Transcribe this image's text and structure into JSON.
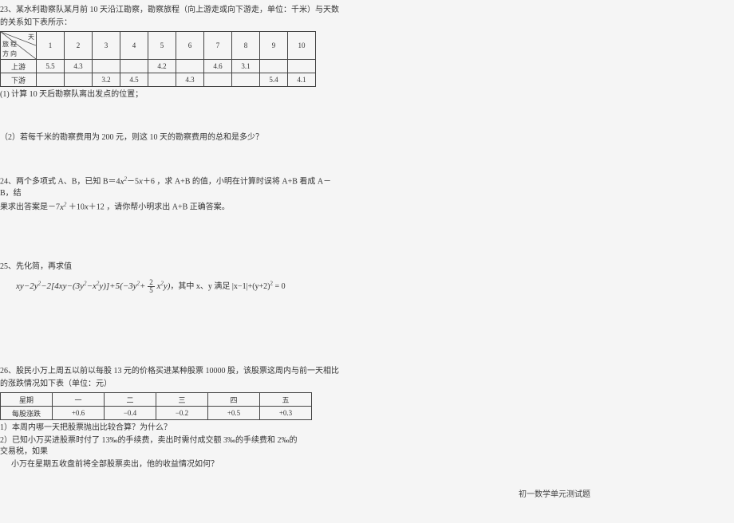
{
  "q23": {
    "intro1": "23、某水利勘察队某月前 10 天沿江勘察，勘察旅程（向上游走或向下游走，单位：千米）与天数",
    "intro2": "的关系如下表所示：",
    "diag_top": "天",
    "diag_mid": "旅 程",
    "diag_bot": "方 向",
    "days": [
      "1",
      "2",
      "3",
      "4",
      "5",
      "6",
      "7",
      "8",
      "9",
      "10"
    ],
    "row_up_label": "上游",
    "row_up": [
      "5.5",
      "4.3",
      "",
      "",
      "4.2",
      "",
      "4.6",
      "3.1",
      "",
      ""
    ],
    "row_down_label": "下游",
    "row_down": [
      "",
      "",
      "3.2",
      "4.5",
      "",
      "4.3",
      "",
      "",
      "5.4",
      "4.1"
    ],
    "sub1": "(1) 计算 10 天后勘察队离出发点的位置；",
    "sub2": "（2）若每千米的勘察费用为 200 元，则这 10 天的勘察费用的总和是多少？"
  },
  "q24": {
    "l1": "24、两个多项式 A、B，已知 B＝4",
    "l1b": "－5",
    "l1c": "＋6 ，求 A+B 的值，小明在计算时误将 A+B 看成 A－B，结",
    "l2a": "果求出答案是－7",
    "l2b": " ＋10",
    "l2c": "＋12 ，请你帮小明求出 A+B 正确答案。"
  },
  "q25": {
    "title": "25、先化简，再求值",
    "tail": "，其中 x、y 满足 |x−1|+(y+2)",
    "eq0": " = 0"
  },
  "q26": {
    "intro1": "26、股民小万上周五以前以每股 13 元的价格买进某种股票 10000 股，该股票这周内与前一天相比",
    "intro2": "的涨跌情况如下表（单位：元）",
    "hdr": [
      "星期",
      "一",
      "二",
      "三",
      "四",
      "五"
    ],
    "row": [
      "每股涨跌",
      "+0.6",
      "−0.4",
      "−0.2",
      "+0.5",
      "+0.3"
    ],
    "sub1": "1）本周内哪一天把股票抛出比较合算？为什么？"
  },
  "q26b": {
    "l1": "2）已知小万买进股票时付了 13‰的手续费，卖出时需付成交额 3‰的手续费和 2‰的交易税，如果",
    "l2": "小万在星期五收盘前将全部股票卖出，他的收益情况如何？"
  },
  "footer": "初一数学单元测试题"
}
